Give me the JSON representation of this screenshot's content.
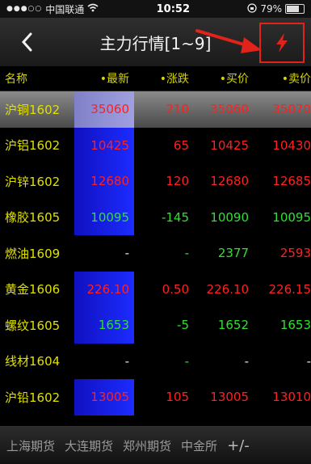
{
  "status": {
    "carrier": "中国联通",
    "time": "10:52",
    "battery": "79%"
  },
  "nav": {
    "title": "主力行情[1~9]"
  },
  "columns": {
    "name": "名称",
    "last": "•最新",
    "chg": "•涨跌",
    "bid": "•买价",
    "ask": "•卖价"
  },
  "rows": [
    {
      "name": "沪铜1602",
      "last": "35060",
      "chg": "210",
      "bid": "35060",
      "ask": "35070"
    },
    {
      "name": "沪铝1602",
      "last": "10425",
      "chg": "65",
      "bid": "10425",
      "ask": "10430"
    },
    {
      "name": "沪锌1602",
      "last": "12680",
      "chg": "120",
      "bid": "12680",
      "ask": "12685"
    },
    {
      "name": "橡胶1605",
      "last": "10095",
      "chg": "-145",
      "bid": "10090",
      "ask": "10095"
    },
    {
      "name": "燃油1609",
      "last": "-",
      "chg": "-",
      "bid": "2377",
      "ask": "2593"
    },
    {
      "name": "黄金1606",
      "last": "226.10",
      "chg": "0.50",
      "bid": "226.10",
      "ask": "226.15"
    },
    {
      "name": "螺纹1605",
      "last": "1653",
      "chg": "-5",
      "bid": "1652",
      "ask": "1653"
    },
    {
      "name": "线材1604",
      "last": "-",
      "chg": "-",
      "bid": "-",
      "ask": "-"
    },
    {
      "name": "沪铅1602",
      "last": "13005",
      "chg": "105",
      "bid": "13005",
      "ask": "13010"
    }
  ],
  "bottom_tabs": [
    "上海期货",
    "大连期货",
    "郑州期货",
    "中金所"
  ],
  "bottom_toggle": "+/-",
  "colors": {
    "up": "#ff2020",
    "down": "#30e030",
    "name": "#e0e000",
    "highlight_box": "#e2231a"
  }
}
